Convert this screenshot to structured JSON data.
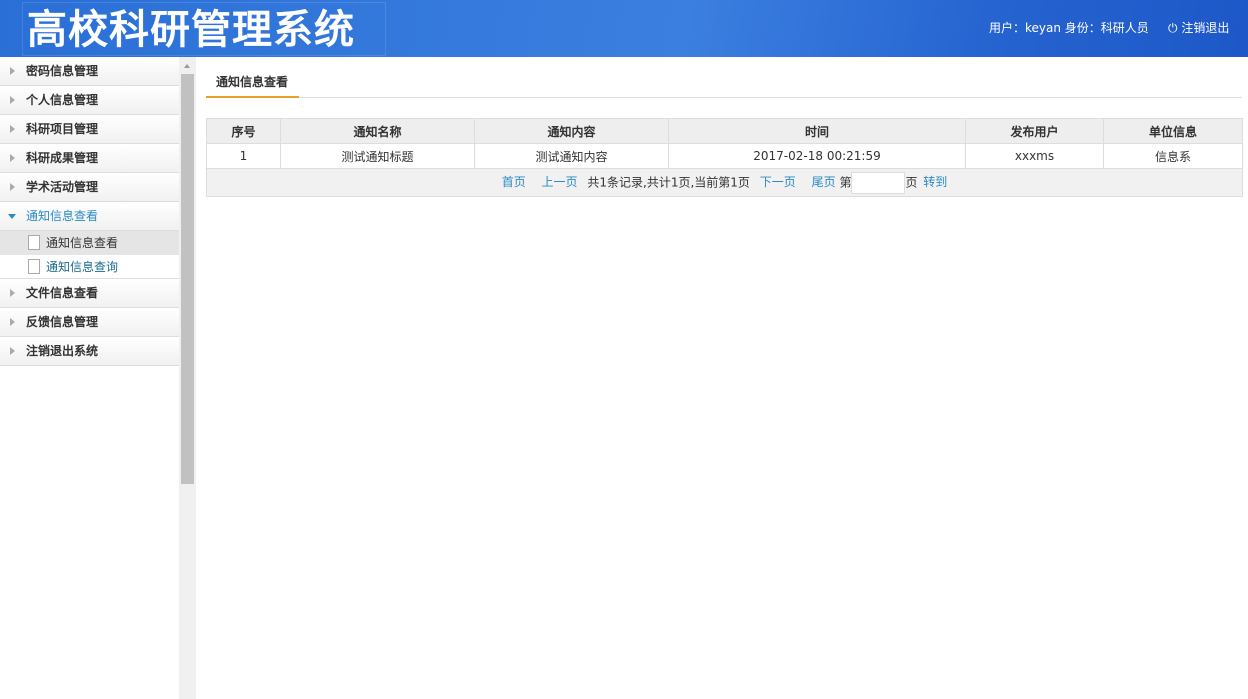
{
  "header": {
    "title": "高校科研管理系统",
    "user_info": "用户：keyan 身份：科研人员",
    "logout": "注销退出"
  },
  "sidebar": {
    "menus": [
      "密码信息管理",
      "个人信息管理",
      "科研项目管理",
      "科研成果管理",
      "学术活动管理",
      "通知信息查看",
      "文件信息查看",
      "反馈信息管理",
      "注销退出系统"
    ],
    "subitems": [
      "通知信息查看",
      "通知信息查询"
    ]
  },
  "main": {
    "tab": "通知信息查看",
    "columns": [
      "序号",
      "通知名称",
      "通知内容",
      "时间",
      "发布用户",
      "单位信息"
    ],
    "rows": [
      [
        "1",
        "测试通知标题",
        "测试通知内容",
        "2017-02-18 00:21:59",
        "xxxms",
        "信息系"
      ]
    ],
    "pager": {
      "first": "首页",
      "prev": "上一页",
      "summary": "共1条记录,共计1页,当前第1页",
      "next": "下一页",
      "last": "尾页",
      "page_prefix": "第",
      "page_value": "",
      "page_suffix": "页",
      "go": "转到"
    }
  }
}
